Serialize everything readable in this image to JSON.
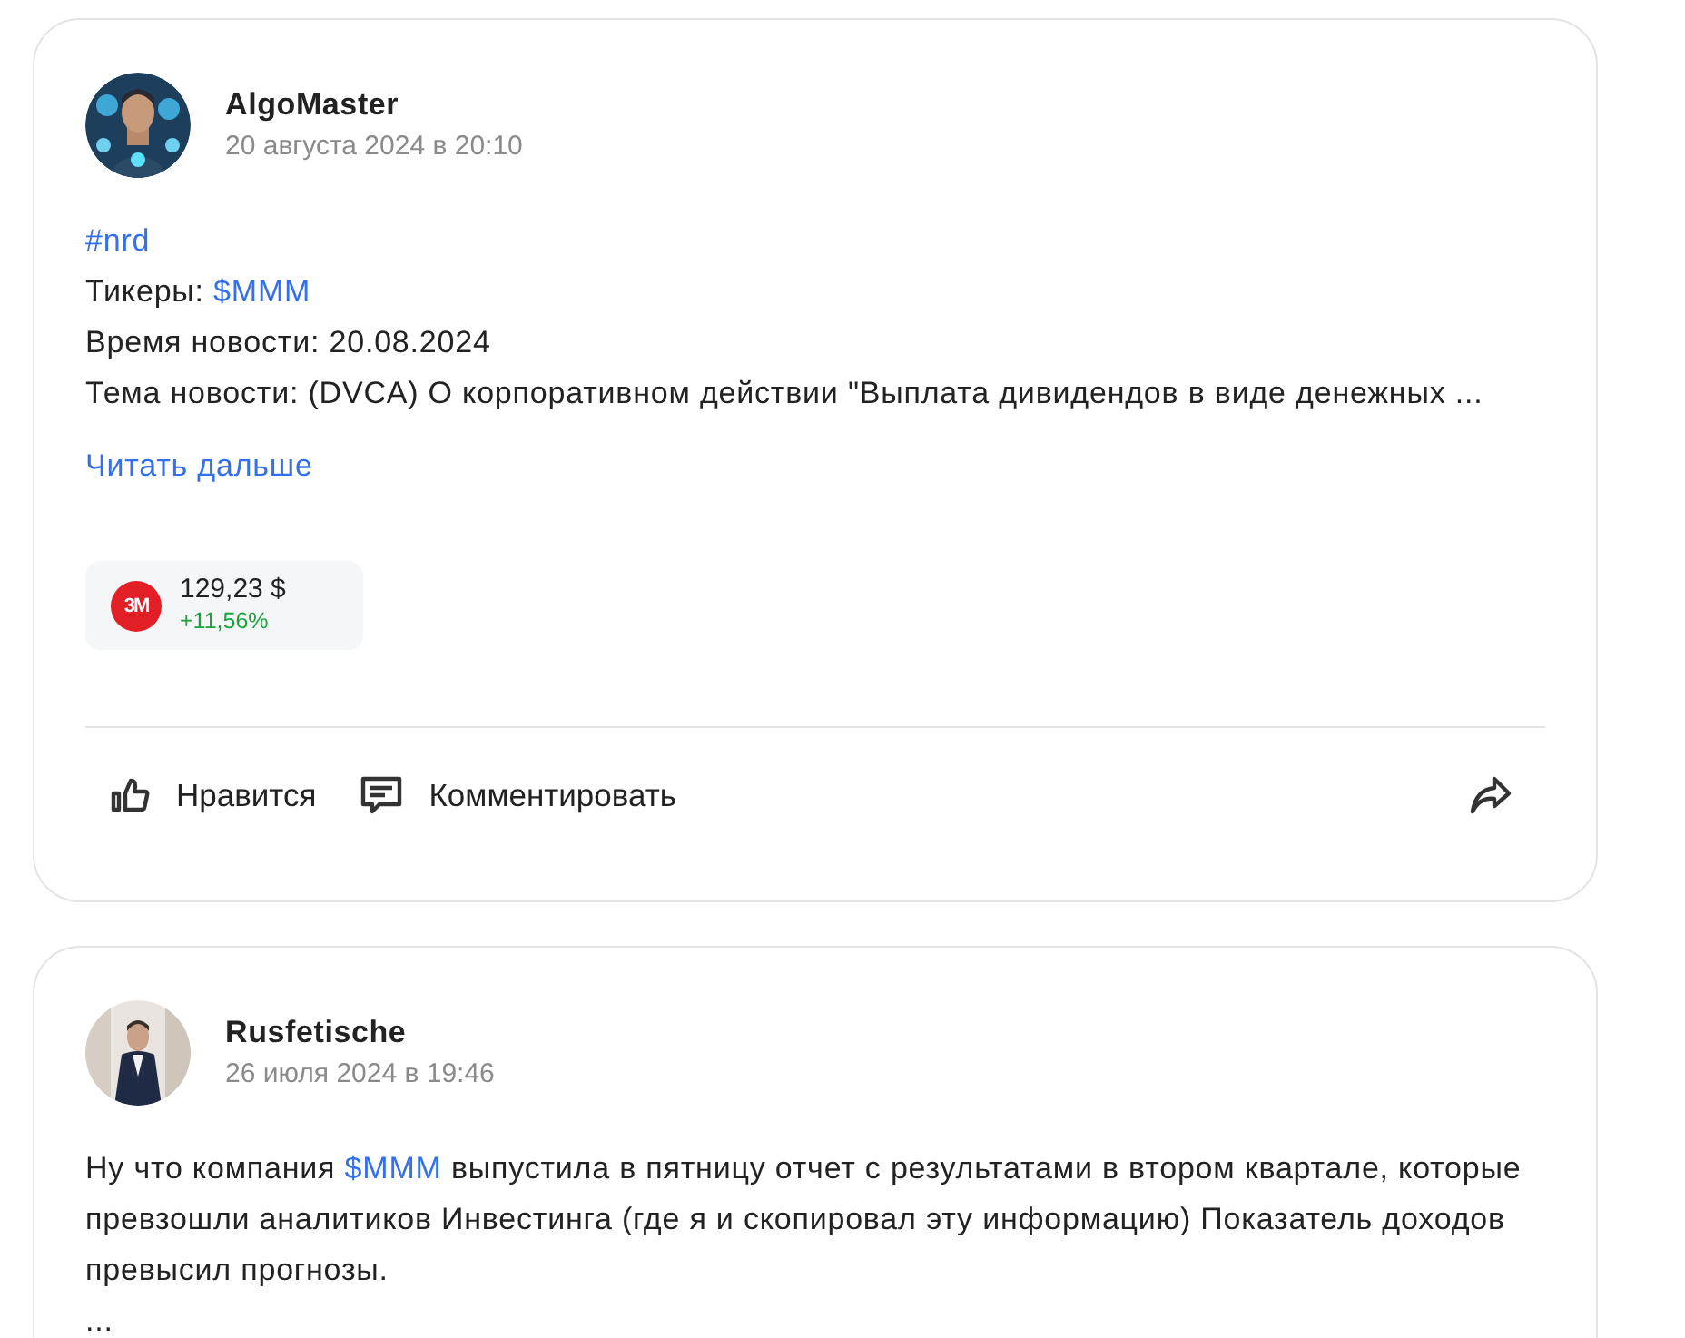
{
  "posts": [
    {
      "author": "AlgoMaster",
      "date": "20 августа 2024 в 20:10",
      "avatar": {
        "kind": "picture"
      },
      "lines": [
        [
          {
            "kind": "link",
            "text": "#nrd"
          }
        ],
        [
          {
            "kind": "plain",
            "text": "Тикеры: "
          },
          {
            "kind": "link",
            "text": "$MMM"
          }
        ],
        [
          {
            "kind": "plain",
            "text": "Время новости: 20.08.2024"
          }
        ],
        [
          {
            "kind": "plain",
            "text": "Тема новости: (DVCA) О корпоративном действии \"Выплата дивидендов в виде денежных ..."
          }
        ]
      ],
      "read_more": "Читать дальше",
      "ticker": {
        "logo": "3M",
        "price": "129,23 $",
        "change": "+11,56%"
      },
      "actions": {
        "like": "Нравится",
        "comment": "Комментировать"
      }
    },
    {
      "author": "Rusfetische",
      "date": "26 июля 2024 в 19:46",
      "avatar": {
        "kind": "picture"
      },
      "lines": [
        [
          {
            "kind": "plain",
            "text": "Ну что компания "
          },
          {
            "kind": "link",
            "text": "$MMM"
          },
          {
            "kind": "plain",
            "text": " выпустила в пятницу отчет с результатами в втором квартале, которые превзошли аналитиков Инвестинга (где я и скопировал эту информацию) Показатель доходов превысил прогнозы."
          }
        ],
        [
          {
            "kind": "plain",
            "text": "..."
          }
        ]
      ]
    }
  ]
}
